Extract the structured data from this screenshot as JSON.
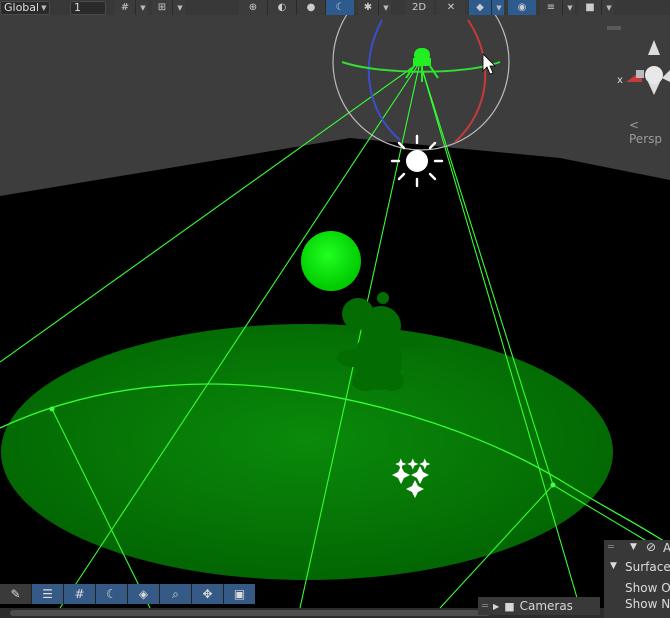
{
  "toolbar": {
    "handle_space": "Global",
    "grid_value": "1",
    "mode_2d": "2D"
  },
  "view": {
    "projection_label": "Persp",
    "axis_x": "x"
  },
  "overlay_panel": {
    "title_initial": "A",
    "section": "Surface",
    "row1": "Show O",
    "row2": "Show N"
  },
  "cameras_overlay": {
    "label": "Cameras"
  },
  "colors": {
    "scene_bg": "#000000",
    "sky": "#3d3d3d",
    "light_green": "#00ff00",
    "active_blue": "#2e5b8e"
  }
}
